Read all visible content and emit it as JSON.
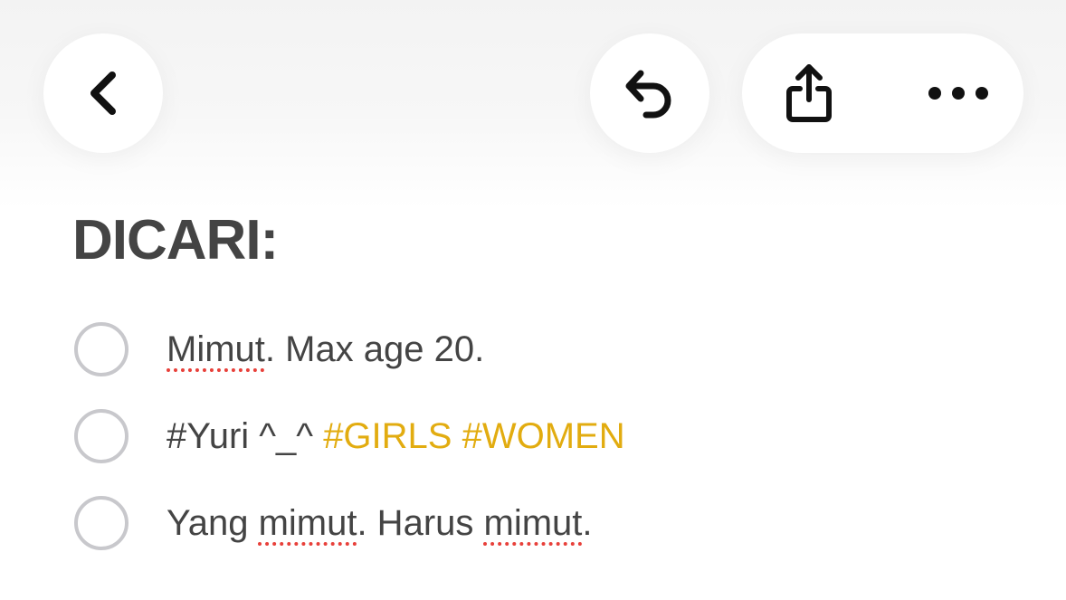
{
  "toolbar": {
    "back_icon": "chevron-left-icon",
    "undo_icon": "undo-icon",
    "share_icon": "share-icon",
    "more_icon": "ellipsis-icon"
  },
  "note": {
    "title": "DICARI:",
    "items": [
      {
        "checked": false,
        "parts": [
          {
            "text": "Mimut",
            "style": "misspelled"
          },
          {
            "text": ". Max age 20.",
            "style": "normal"
          }
        ]
      },
      {
        "checked": false,
        "parts": [
          {
            "text": "#Yuri ^_^ ",
            "style": "normal"
          },
          {
            "text": "#GIRLS #WOMEN",
            "style": "tag"
          }
        ]
      },
      {
        "checked": false,
        "parts": [
          {
            "text": "Yang ",
            "style": "normal"
          },
          {
            "text": "mimut",
            "style": "misspelled"
          },
          {
            "text": ". Harus ",
            "style": "normal"
          },
          {
            "text": "mimut",
            "style": "misspelled"
          },
          {
            "text": ".",
            "style": "normal"
          }
        ]
      }
    ]
  },
  "colors": {
    "text": "#444444",
    "tag": "#e2ac10",
    "checkbox_border": "#c8c8cc",
    "spellcheck_underline": "#e8403a"
  }
}
